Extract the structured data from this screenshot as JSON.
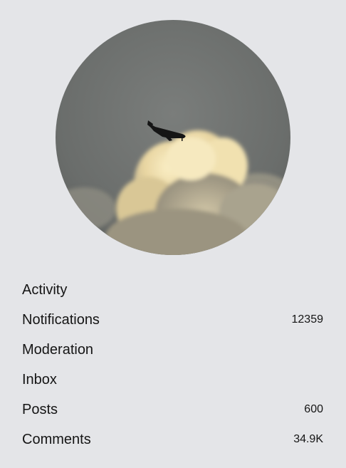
{
  "profile": {
    "avatar_icon": "airplane-over-clouds-avatar"
  },
  "menu": {
    "items": [
      {
        "label": "Activity",
        "count": ""
      },
      {
        "label": "Notifications",
        "count": "12359"
      },
      {
        "label": "Moderation",
        "count": ""
      },
      {
        "label": "Inbox",
        "count": ""
      },
      {
        "label": "Posts",
        "count": "600"
      },
      {
        "label": "Comments",
        "count": "34.9K"
      }
    ]
  },
  "colors": {
    "background": "#e4e5e8",
    "sky": "#6e7170",
    "cloud_highlight": "#f3e3b2"
  }
}
